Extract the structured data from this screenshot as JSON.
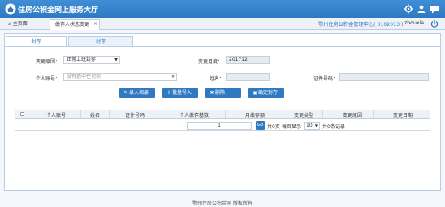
{
  "header": {
    "app_title": "住房公积金网上服务大厅",
    "icons": [
      "gear-icon",
      "user-icon",
      "message-icon"
    ]
  },
  "tabbar": {
    "home_label": "主页面",
    "active_tab_label": "缴存人状态变更",
    "close_glyph": "×",
    "org_info": "鄂州住房公积金管理中心( 0102013 )",
    "username": "zhouxia",
    "logout_icon": "power-icon"
  },
  "subtabs": [
    "封存",
    "封存"
  ],
  "form": {
    "change_reason_label": "变更原因：",
    "change_reason_value": "正常上班封存",
    "change_month_label": "变更月度：",
    "change_month_value": "201712",
    "account_label": "个人账号：",
    "account_placeholder": "没有选中任何项",
    "name_label": "姓名：",
    "name_value": "",
    "id_label": "证件号码：",
    "id_value": ""
  },
  "buttons": {
    "import_label": "录入调册",
    "batch_import_label": "批量导入",
    "delete_label": "删除",
    "confirm_label": "确定封存"
  },
  "table": {
    "columns": [
      "个人账号",
      "姓名",
      "证件号码",
      "个人缴存基数",
      "月缴存额",
      "变更类型",
      "变更原因",
      "变更日期"
    ]
  },
  "pager": {
    "page_value": "1",
    "go_label": "Go",
    "total_pages": "共0页",
    "per_page_label": "每页显示",
    "page_size": "10",
    "total_records": "共0条记录"
  },
  "footer": {
    "copyright": "鄂州住房公积金网 版权所有"
  }
}
